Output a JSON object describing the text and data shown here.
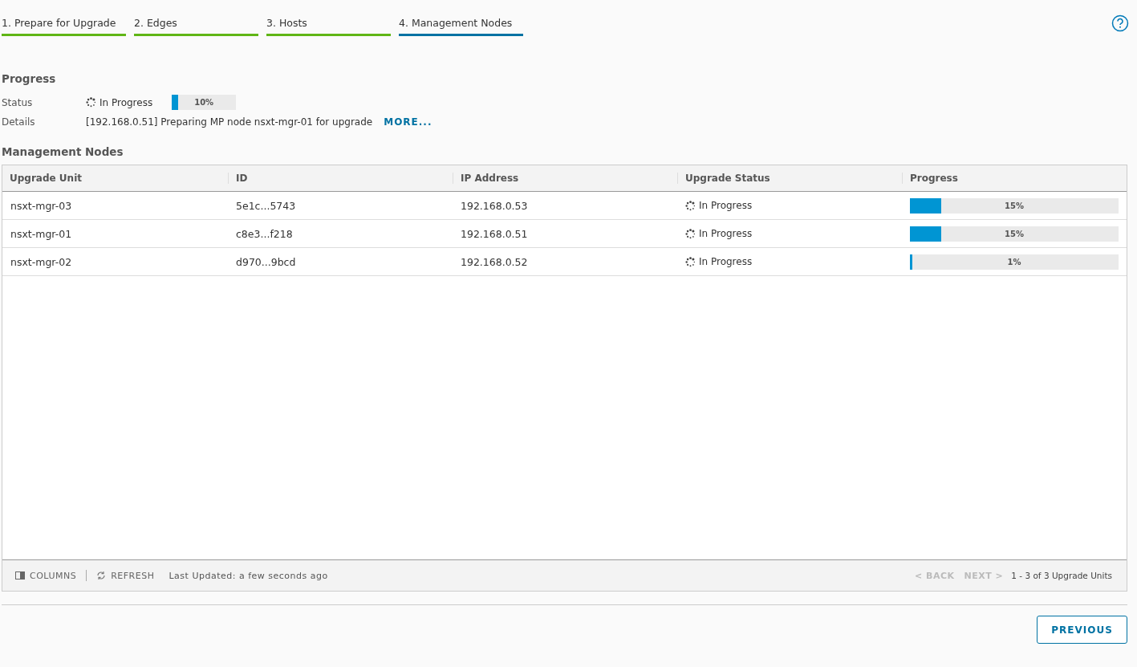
{
  "steps": [
    {
      "label": "1. Prepare for Upgrade",
      "selected": false
    },
    {
      "label": "2. Edges",
      "selected": false
    },
    {
      "label": "3. Hosts",
      "selected": false
    },
    {
      "label": "4. Management Nodes",
      "selected": true
    }
  ],
  "progress": {
    "heading": "Progress",
    "status_label": "Status",
    "status": "In Progress",
    "level": 0.1,
    "percent": "10%",
    "details_label": "Details",
    "details": "[192.168.0.51] Preparing MP node nsxt-mgr-01 for upgrade",
    "more_link": "MORE..."
  },
  "section_title": "Management Nodes",
  "table": {
    "columns": [
      "Upgrade Unit",
      "ID",
      "IP Address",
      "Upgrade Status",
      "Progress"
    ],
    "rows": [
      {
        "unit": "nsxt-mgr-03",
        "id": "5e1c...5743",
        "ip": "192.168.0.53",
        "status": "In Progress",
        "level": 0.15,
        "percent": "15%"
      },
      {
        "unit": "nsxt-mgr-01",
        "id": "c8e3...f218",
        "ip": "192.168.0.51",
        "status": "In Progress",
        "level": 0.15,
        "percent": "15%"
      },
      {
        "unit": "nsxt-mgr-02",
        "id": "d970...9bcd",
        "ip": "192.168.0.52",
        "status": "In Progress",
        "level": 0.01,
        "percent": "1%"
      }
    ],
    "footer": {
      "columns_button": "COLUMNS",
      "refresh_button": "REFRESH",
      "last_updated": "Last Updated: a few seconds ago",
      "back": {
        "label": "BACK",
        "disabled": true
      },
      "next": {
        "label": "NEXT",
        "disabled": true
      },
      "back_arrow": "<",
      "next_arrow": ">",
      "count": "1 - 3 of 3 Upgrade Units"
    }
  },
  "previous_button": "PREVIOUS"
}
